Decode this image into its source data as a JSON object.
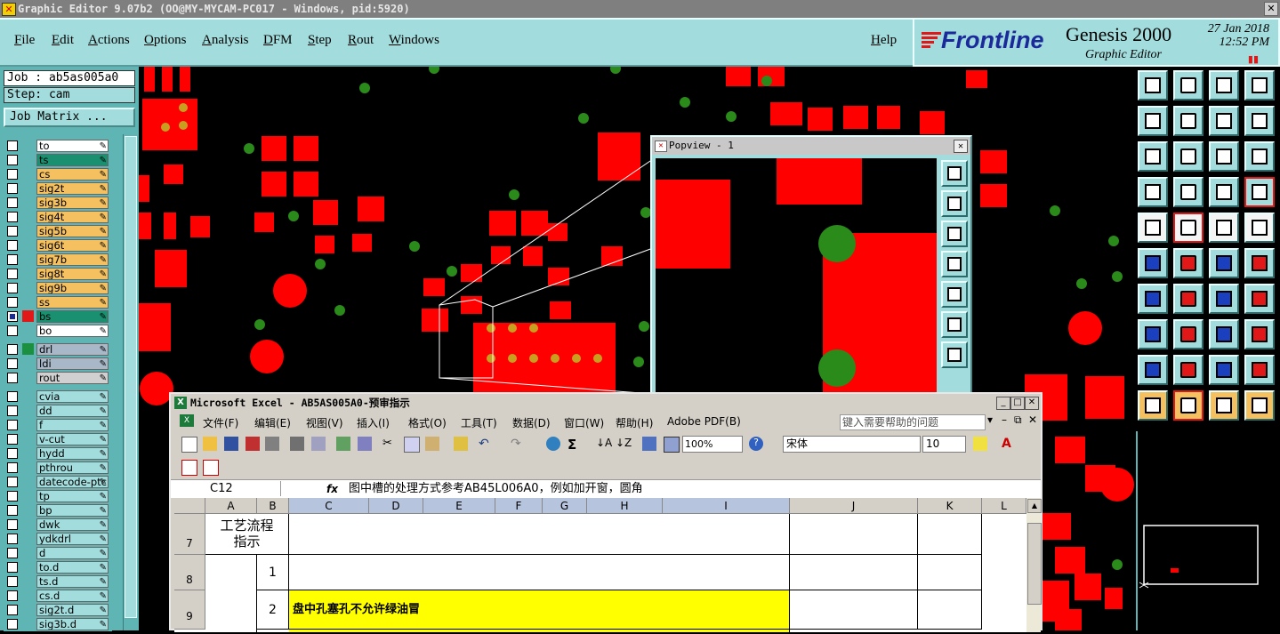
{
  "titlebar": {
    "text": "Graphic Editor 9.07b2 (OO@MY-MYCAM-PC017 - Windows, pid:5920)",
    "close": "✕"
  },
  "menu": {
    "items": [
      "File",
      "Edit",
      "Actions",
      "Options",
      "Analysis",
      "DFM",
      "Step",
      "Rout",
      "Windows"
    ],
    "help": "Help"
  },
  "brand": {
    "logo": "Frontline",
    "product": "Genesis 2000",
    "subtitle": "Graphic Editor",
    "date": "27 Jan 2018",
    "time": "12:52 PM",
    "indicator": "▮▮"
  },
  "job": {
    "job_label": "Job : ab5as005a0",
    "step_label": "Step: cam",
    "matrix_button": "Job Matrix ..."
  },
  "layers": {
    "board": [
      {
        "name": "to",
        "color": "#ffffff",
        "selcolor": "#5fb4b4"
      },
      {
        "name": "ts",
        "color": "#1a9070",
        "selcolor": "#5fb4b4"
      },
      {
        "name": "cs",
        "color": "#f4c060",
        "selcolor": "#5fb4b4"
      },
      {
        "name": "sig2t",
        "color": "#f4c060",
        "selcolor": "#5fb4b4"
      },
      {
        "name": "sig3b",
        "color": "#f4c060",
        "selcolor": "#5fb4b4"
      },
      {
        "name": "sig4t",
        "color": "#f4c060",
        "selcolor": "#5fb4b4"
      },
      {
        "name": "sig5b",
        "color": "#f4c060",
        "selcolor": "#5fb4b4"
      },
      {
        "name": "sig6t",
        "color": "#f4c060",
        "selcolor": "#5fb4b4"
      },
      {
        "name": "sig7b",
        "color": "#f4c060",
        "selcolor": "#5fb4b4"
      },
      {
        "name": "sig8t",
        "color": "#f4c060",
        "selcolor": "#5fb4b4"
      },
      {
        "name": "sig9b",
        "color": "#f4c060",
        "selcolor": "#5fb4b4"
      },
      {
        "name": "ss",
        "color": "#f4c060",
        "selcolor": "#5fb4b4"
      },
      {
        "name": "bs",
        "color": "#1a9070",
        "selcolor": "#e01818"
      },
      {
        "name": "bo",
        "color": "#ffffff",
        "selcolor": "#5fb4b4"
      }
    ],
    "drill": [
      {
        "name": "drl",
        "color": "#a8b8c8",
        "selcolor": "#1a9040"
      },
      {
        "name": "ldi",
        "color": "#a8b8c8",
        "selcolor": "#5fb4b4"
      },
      {
        "name": "rout",
        "color": "#d0d0d0",
        "selcolor": "#5fb4b4"
      }
    ],
    "misc": [
      {
        "name": "cvia",
        "color": "#a3dcdc"
      },
      {
        "name": "dd",
        "color": "#a3dcdc"
      },
      {
        "name": "f",
        "color": "#a3dcdc"
      },
      {
        "name": "v-cut",
        "color": "#a3dcdc"
      },
      {
        "name": "hydd",
        "color": "#a3dcdc"
      },
      {
        "name": "pthrou",
        "color": "#a3dcdc"
      },
      {
        "name": "datecode-ptc",
        "color": "#a3dcdc"
      },
      {
        "name": "tp",
        "color": "#a3dcdc"
      },
      {
        "name": "bp",
        "color": "#a3dcdc"
      },
      {
        "name": "dwk",
        "color": "#a3dcdc"
      },
      {
        "name": "ydkdrl",
        "color": "#a3dcdc"
      },
      {
        "name": "d",
        "color": "#a3dcdc"
      },
      {
        "name": "to.d",
        "color": "#a3dcdc"
      },
      {
        "name": "ts.d",
        "color": "#a3dcdc"
      },
      {
        "name": "cs.d",
        "color": "#a3dcdc"
      },
      {
        "name": "sig2t.d",
        "color": "#a3dcdc"
      },
      {
        "name": "sig3b.d",
        "color": "#a3dcdc"
      }
    ]
  },
  "popview": {
    "title": "Popview - 1",
    "close": "✕"
  },
  "excel": {
    "title": "Microsoft Excel - AB5AS005A0-预审指示",
    "menu": [
      "文件(F)",
      "编辑(E)",
      "视图(V)",
      "插入(I)",
      "格式(O)",
      "工具(T)",
      "数据(D)",
      "窗口(W)",
      "帮助(H)",
      "Adobe PDF(B)"
    ],
    "help_placeholder": "键入需要帮助的问题",
    "zoom": "100%",
    "font": "宋体",
    "font_size": "10",
    "name_box": "C12",
    "fx": "fx",
    "formula": "图中槽的处理方式参考AB45L006A0，例如加开窗，圆角",
    "columns": [
      "A",
      "B",
      "C",
      "D",
      "E",
      "F",
      "G",
      "H",
      "I",
      "J",
      "K",
      "L"
    ],
    "rows": [
      "7",
      "8",
      "9"
    ],
    "process_header": "工艺流程指示",
    "item_numbers": [
      "1",
      "2"
    ],
    "instruction": "盘中孔塞孔不允许绿油冒"
  },
  "colors": {
    "pad": "#ff0000",
    "via": "#2a8a1a",
    "teal": "#a3dcdc",
    "selection_line": "#ffffff"
  }
}
